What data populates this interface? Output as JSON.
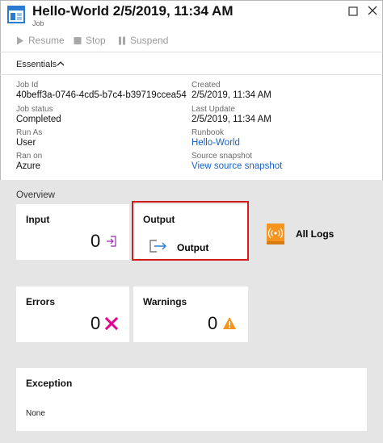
{
  "header": {
    "title": "Hello-World 2/5/2019, 11:34 AM",
    "subtitle": "Job"
  },
  "toolbar": {
    "resume": "Resume",
    "stop": "Stop",
    "suspend": "Suspend"
  },
  "essentials": {
    "label": "Essentials",
    "job_id_label": "Job Id",
    "job_id": "40beff3a-0746-4cd5-b7c4-b39719ccea54",
    "job_status_label": "Job status",
    "job_status": "Completed",
    "run_as_label": "Run As",
    "run_as": "User",
    "ran_on_label": "Ran on",
    "ran_on": "Azure",
    "created_label": "Created",
    "created": "2/5/2019, 11:34 AM",
    "last_update_label": "Last Update",
    "last_update": "2/5/2019, 11:34 AM",
    "runbook_label": "Runbook",
    "runbook": "Hello-World",
    "source_snapshot_label": "Source snapshot",
    "source_snapshot": "View source snapshot"
  },
  "overview": {
    "label": "Overview",
    "input": {
      "title": "Input",
      "count": "0"
    },
    "output": {
      "title": "Output",
      "item": "Output"
    },
    "all_logs": {
      "title": "All Logs"
    },
    "errors": {
      "title": "Errors",
      "count": "0"
    },
    "warnings": {
      "title": "Warnings",
      "count": "0"
    },
    "exception": {
      "title": "Exception",
      "value": "None"
    }
  },
  "colors": {
    "link": "#1a63c6",
    "highlight_border": "#d51c1c",
    "error_x": "#e3008c",
    "warning": "#f7931a",
    "logs_icon": "#f7941d",
    "input_icon": "#9c27b0"
  }
}
